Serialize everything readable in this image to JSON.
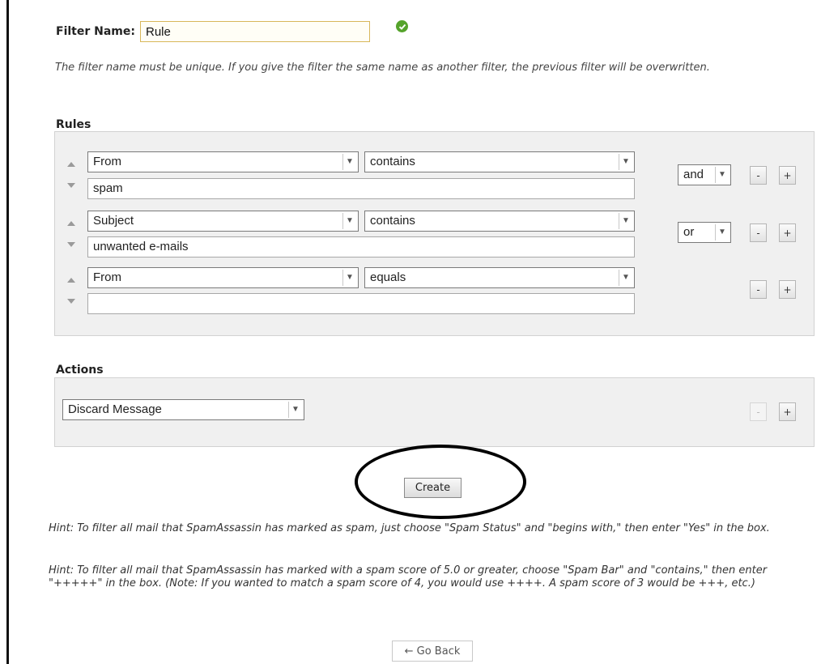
{
  "filter": {
    "label": "Filter Name:",
    "value": "Rule",
    "note": "The filter name must be unique. If you give the filter the same name as another filter, the previous filter will be overwritten."
  },
  "rules": {
    "title": "Rules",
    "rows": [
      {
        "field": "From",
        "operator": "contains",
        "value": "spam",
        "connector": "and"
      },
      {
        "field": "Subject",
        "operator": "contains",
        "value": "unwanted e-mails",
        "connector": "or"
      },
      {
        "field": "From",
        "operator": "equals",
        "value": ""
      }
    ]
  },
  "actions": {
    "title": "Actions",
    "action": "Discard Message"
  },
  "buttons": {
    "minus": "-",
    "plus": "+",
    "create": "Create",
    "back": "← Go Back"
  },
  "hints": [
    "Hint: To filter all mail that SpamAssassin has marked as spam, just choose \"Spam Status\" and \"begins with,\" then enter \"Yes\" in the box.",
    "Hint: To filter all mail that SpamAssassin has marked with a spam score of 5.0 or greater, choose \"Spam Bar\" and \"contains,\" then enter \"+++++\" in the box. (Note: If you wanted to match a spam score of 4, you would use ++++. A spam score of 3 would be +++, etc.)"
  ],
  "colors": {
    "ok_icon": "#55a32b",
    "panel_bg": "#f0f0f0",
    "annotation_ellipse": "#000000"
  },
  "icons": {
    "valid": "checkmark-circle-icon",
    "move_up": "up-arrow-icon",
    "move_down": "down-arrow-icon",
    "dropdown": "chevron-down-icon"
  }
}
